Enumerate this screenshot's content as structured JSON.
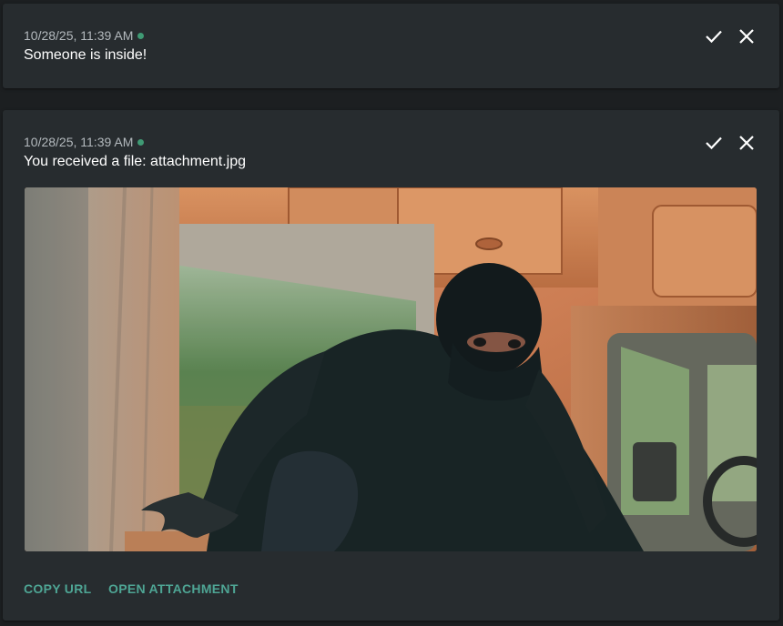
{
  "notifications": [
    {
      "timestamp": "10/28/25, 11:39 AM",
      "message": "Someone is inside!"
    },
    {
      "timestamp": "10/28/25, 11:39 AM",
      "message": "You received a file: attachment.jpg",
      "attachment_alt": "attachment.jpg",
      "actions": {
        "copy_url": "COPY URL",
        "open_attachment": "OPEN ATTACHMENT"
      }
    }
  ],
  "colors": {
    "status_dot": "#3f9a74",
    "action_text": "#4ea594",
    "card_bg": "#272c2f"
  },
  "icons": [
    "check-icon",
    "close-icon"
  ]
}
